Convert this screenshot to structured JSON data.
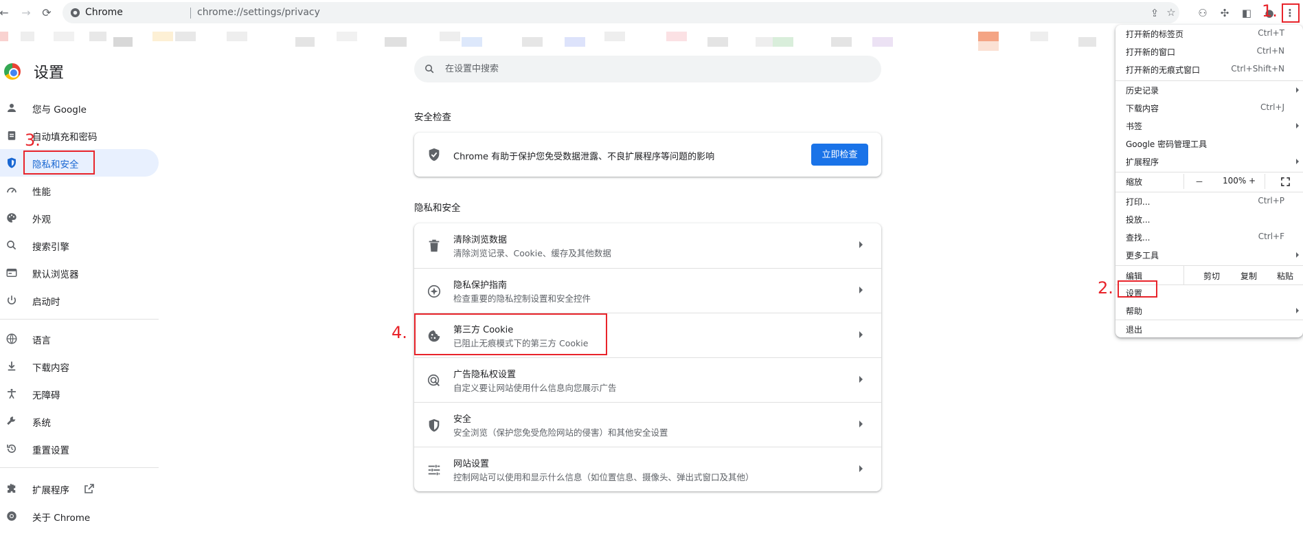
{
  "toolbar": {
    "site_name": "Chrome",
    "url": "chrome://settings/privacy"
  },
  "sidebar": {
    "title": "设置",
    "items": [
      {
        "label": "您与 Google",
        "icon": "person-icon"
      },
      {
        "label": "自动填充和密码",
        "icon": "clipboard-icon"
      },
      {
        "label": "隐私和安全",
        "icon": "shield-icon",
        "active": true
      },
      {
        "label": "性能",
        "icon": "speedometer-icon"
      },
      {
        "label": "外观",
        "icon": "palette-icon"
      },
      {
        "label": "搜索引擎",
        "icon": "search-icon"
      },
      {
        "label": "默认浏览器",
        "icon": "browser-icon"
      },
      {
        "label": "启动时",
        "icon": "power-icon"
      },
      {
        "label": "语言",
        "icon": "globe-icon"
      },
      {
        "label": "下载内容",
        "icon": "download-icon"
      },
      {
        "label": "无障碍",
        "icon": "accessibility-icon"
      },
      {
        "label": "系统",
        "icon": "wrench-icon"
      },
      {
        "label": "重置设置",
        "icon": "reset-icon"
      },
      {
        "label": "扩展程序",
        "icon": "puzzle-icon"
      },
      {
        "label": "关于 Chrome",
        "icon": "chrome-icon"
      }
    ]
  },
  "search": {
    "placeholder": "在设置中搜索"
  },
  "safety_check": {
    "title": "安全检查",
    "text": "Chrome 有助于保护您免受数据泄露、不良扩展程序等问题的影响",
    "button": "立即检查"
  },
  "privacy": {
    "title": "隐私和安全",
    "rows": [
      {
        "title": "清除浏览数据",
        "subtitle": "清除浏览记录、Cookie、缓存及其他数据",
        "icon": "trash-icon"
      },
      {
        "title": "隐私保护指南",
        "subtitle": "检查重要的隐私控制设置和安全控件",
        "icon": "compass-icon"
      },
      {
        "title": "第三方 Cookie",
        "subtitle": "已阻止无痕模式下的第三方 Cookie",
        "icon": "cookie-icon"
      },
      {
        "title": "广告隐私权设置",
        "subtitle": "自定义要让网站使用什么信息向您展示广告",
        "icon": "ads-privacy-icon"
      },
      {
        "title": "安全",
        "subtitle": "安全浏览（保护您免受危险网站的侵害）和其他安全设置",
        "icon": "shield-icon"
      },
      {
        "title": "网站设置",
        "subtitle": "控制网站可以使用和显示什么信息（如位置信息、摄像头、弹出式窗口及其他）",
        "icon": "sliders-icon"
      }
    ]
  },
  "menu": {
    "items": [
      {
        "label": "打开新的标签页",
        "shortcut": "Ctrl+T"
      },
      {
        "label": "打开新的窗口",
        "shortcut": "Ctrl+N"
      },
      {
        "label": "打开新的无痕式窗口",
        "shortcut": "Ctrl+Shift+N"
      },
      {
        "label": "历史记录",
        "submenu": true
      },
      {
        "label": "下载内容",
        "shortcut": "Ctrl+J"
      },
      {
        "label": "书签",
        "submenu": true
      },
      {
        "label": "Google 密码管理工具"
      },
      {
        "label": "扩展程序",
        "submenu": true
      },
      {
        "label": "打印...",
        "shortcut": "Ctrl+P"
      },
      {
        "label": "投放..."
      },
      {
        "label": "查找...",
        "shortcut": "Ctrl+F"
      },
      {
        "label": "更多工具",
        "submenu": true
      },
      {
        "label": "设置"
      },
      {
        "label": "帮助",
        "submenu": true
      },
      {
        "label": "退出"
      }
    ],
    "zoom": {
      "label": "缩放",
      "minus": "－",
      "value": "100%",
      "plus": "+"
    },
    "edit": {
      "label": "编辑",
      "cut": "剪切",
      "copy": "复制",
      "paste": "粘贴"
    }
  },
  "annotations": {
    "step1": "1.",
    "step2": "2.",
    "step3": "3.",
    "step4": "4."
  },
  "colors": {
    "accent": "#1a73e8",
    "annotation": "#e8232a",
    "active_nav_bg": "#e8f0fe"
  }
}
